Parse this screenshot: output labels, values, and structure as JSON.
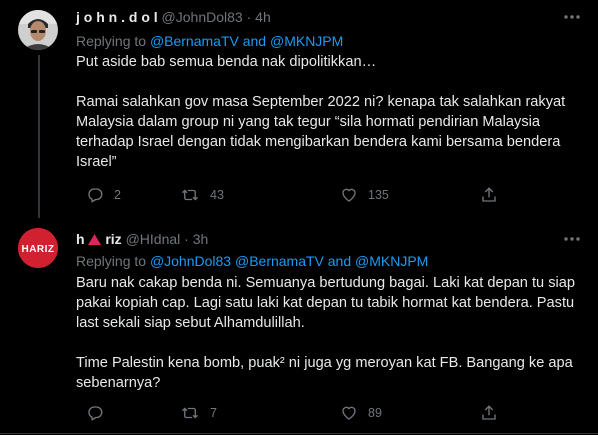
{
  "tweets": [
    {
      "display_name": "j o h n . d o l",
      "handle": "@JohnDol83",
      "separator": "·",
      "time": "4h",
      "replying_prefix": "Replying to",
      "replying_to": "@BernamaTV and @MKNJPM",
      "paragraphs": [
        "Put aside bab semua benda nak dipolitikkan…",
        "Ramai salahkan gov masa September 2022 ni? kenapa tak salahkan rakyat Malaysia dalam group ni yang tak tegur “sila hormati pendirian Malaysia terhadap Israel dengan tidak mengibarkan bendera kami bersama bendera Israel”"
      ],
      "replies": "2",
      "retweets": "43",
      "likes": "135"
    },
    {
      "display_name_pre": "h",
      "display_name_post": "riz",
      "handle": "@HIdnal",
      "separator": "·",
      "time": "3h",
      "replying_prefix": "Replying to",
      "replying_to": "@JohnDol83 @BernamaTV and @MKNJPM",
      "avatar_text": "HARIZ",
      "paragraphs": [
        "Baru nak cakap benda ni. Semuanya bertudung bagai. Laki kat depan tu siap pakai kopiah cap. Lagi satu laki kat depan tu tabik hormat kat bendera. Pastu last sekali siap sebut Alhamdulillah.",
        "Time Palestin kena bomb, puak² ni juga yg meroyan kat FB. Bangang ke apa sebenarnya?"
      ],
      "replies": "",
      "retweets": "7",
      "likes": "89"
    }
  ],
  "colors": {
    "background": "#000000",
    "text": "#e7e9ea",
    "secondary": "#71767b",
    "link": "#1d9bf0",
    "hariz_red": "#d1202f",
    "divider": "#2f3336"
  }
}
